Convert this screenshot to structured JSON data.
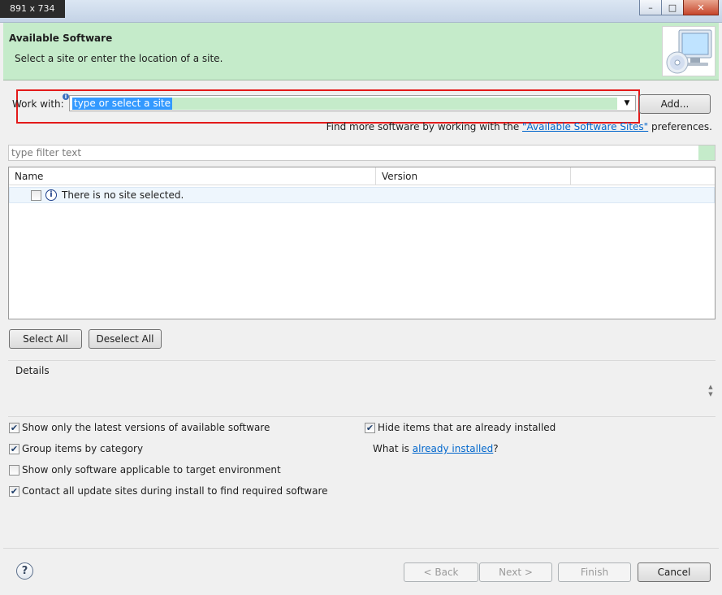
{
  "window": {
    "dimensions_label": "891 x 734",
    "minimize_glyph": "–",
    "maximize_glyph": "□",
    "close_glyph": "✕"
  },
  "header": {
    "title": "Available Software",
    "description": "Select a site or enter the location of a site.",
    "icon": "monitor-cd-icon"
  },
  "work_with": {
    "label": "Work with:",
    "info_glyph": "i",
    "placeholder": "type or select a site",
    "dropdown_glyph": "▼",
    "add_label": "Add...",
    "find_more_prefix": "Find more software by working with the ",
    "find_more_link": "\"Available Software Sites\"",
    "find_more_suffix": " preferences."
  },
  "filter": {
    "placeholder": "type filter text"
  },
  "table": {
    "columns": [
      "Name",
      "Version"
    ],
    "rows": [
      {
        "checked": false,
        "icon": "info-icon",
        "icon_glyph": "i",
        "name": "There is no site selected.",
        "version": ""
      }
    ]
  },
  "selection_buttons": {
    "select_all": "Select All",
    "deselect_all": "Deselect All"
  },
  "details": {
    "label": "Details",
    "scroll_up": "▲",
    "scroll_down": "▼"
  },
  "options": {
    "latest_versions": {
      "label": "Show only the latest versions of available software",
      "checked": true
    },
    "group_by_category": {
      "label": "Group items by category",
      "checked": true
    },
    "target_env": {
      "label": "Show only software applicable to target environment",
      "checked": false
    },
    "contact_sites": {
      "label": "Contact all update sites during install to find required software",
      "checked": true
    },
    "hide_installed": {
      "label": "Hide items that are already installed",
      "checked": true
    },
    "what_is_prefix": "What is ",
    "what_is_link": "already installed",
    "what_is_suffix": "?"
  },
  "footer": {
    "help_glyph": "?",
    "back": "< Back",
    "next": "Next >",
    "finish": "Finish",
    "cancel": "Cancel"
  },
  "colors": {
    "banner_bg": "#c5ebca",
    "highlight_border": "#e31a1a",
    "selection_bg": "#3399ff",
    "link": "#0066cc"
  }
}
